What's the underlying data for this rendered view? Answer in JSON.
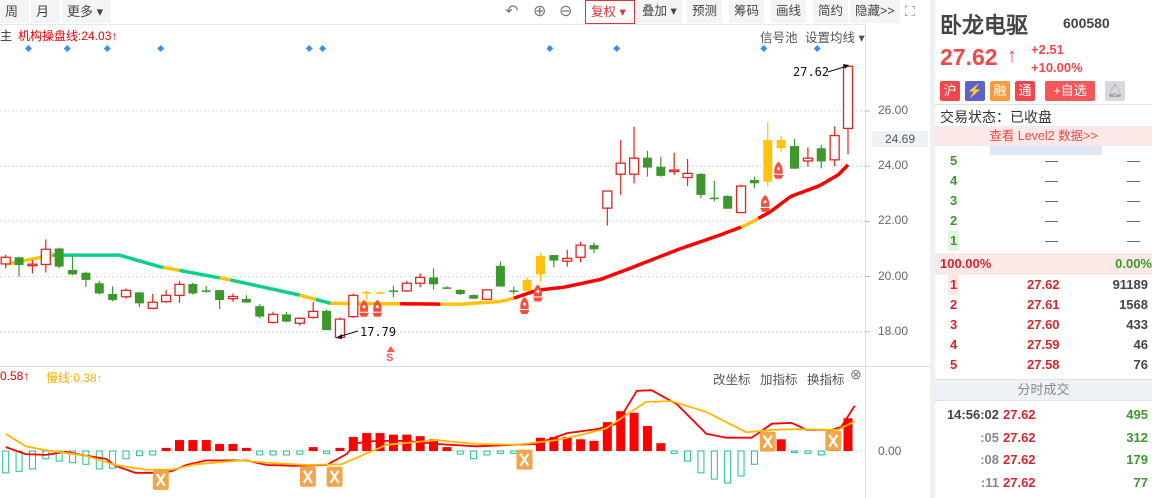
{
  "toolbar": {
    "left": [
      "周",
      "月",
      "更多 ▾"
    ],
    "fuquan": "复权 ▾",
    "right": [
      "叠加 ▾",
      "预测",
      "筹码",
      "画线",
      "简约",
      "隐藏>>"
    ]
  },
  "indicator_bar": {
    "main_cut": "主",
    "ma_label": "机构操盘线:24.03↑",
    "signal_pool": "信号池",
    "set_ma": "设置均线 ▾"
  },
  "price_axis": {
    "labels": [
      "26.00",
      "24.00",
      "22.00",
      "20.00",
      "18.00"
    ],
    "label_values": [
      26,
      24,
      22,
      20,
      18
    ],
    "current": "24.69",
    "current_value": 24.69
  },
  "annotations": {
    "high": "27.62",
    "low": "17.79",
    "s_mark": "S"
  },
  "colors": {
    "up": "#e0251f",
    "down": "#3d982c",
    "special": "#ffc20e",
    "teal": "#0ccf8a",
    "red_line": "#ff0000",
    "blue": "#3a8ff0"
  },
  "chart_data": {
    "type": "candlestick",
    "ohlc": [
      [
        20.46,
        20.8,
        20.3,
        20.7
      ],
      [
        20.7,
        20.72,
        20.0,
        20.42
      ],
      [
        20.43,
        20.6,
        20.12,
        20.45
      ],
      [
        20.44,
        21.35,
        20.15,
        20.99
      ],
      [
        21.02,
        21.05,
        20.3,
        20.36
      ],
      [
        20.24,
        20.76,
        20.05,
        20.08
      ],
      [
        20.14,
        20.18,
        19.63,
        19.88
      ],
      [
        19.76,
        19.85,
        19.35,
        19.39
      ],
      [
        19.37,
        19.65,
        19.1,
        19.15
      ],
      [
        19.27,
        19.57,
        19.2,
        19.5
      ],
      [
        19.43,
        19.45,
        18.9,
        19.03
      ],
      [
        18.85,
        19.37,
        18.82,
        19.07
      ],
      [
        19.09,
        19.52,
        19.05,
        19.32
      ],
      [
        19.32,
        19.84,
        19.05,
        19.72
      ],
      [
        19.73,
        19.78,
        19.35,
        19.39
      ],
      [
        19.5,
        19.66,
        19.42,
        19.48
      ],
      [
        19.51,
        19.52,
        18.82,
        19.15
      ],
      [
        19.2,
        19.39,
        19.09,
        19.28
      ],
      [
        19.19,
        19.33,
        19.05,
        19.06
      ],
      [
        18.93,
        19.0,
        18.5,
        18.55
      ],
      [
        18.34,
        18.73,
        18.3,
        18.63
      ],
      [
        18.63,
        18.72,
        18.35,
        18.37
      ],
      [
        18.31,
        18.52,
        18.22,
        18.49
      ],
      [
        18.52,
        19.08,
        18.47,
        18.74
      ],
      [
        18.76,
        18.81,
        18.06,
        18.06
      ],
      [
        17.8,
        18.52,
        17.79,
        18.46
      ],
      [
        18.55,
        19.39,
        18.5,
        19.32
      ],
      [
        19.42,
        19.49,
        19.15,
        19.44
      ],
      [
        19.41,
        19.48,
        19.38,
        19.43
      ],
      [
        19.5,
        19.67,
        19.25,
        19.48
      ],
      [
        19.48,
        19.85,
        19.45,
        19.76
      ],
      [
        19.76,
        20.12,
        19.61,
        19.97
      ],
      [
        19.97,
        20.3,
        19.53,
        19.72
      ],
      [
        19.61,
        19.65,
        19.55,
        19.59
      ],
      [
        19.52,
        19.54,
        19.33,
        19.37
      ],
      [
        19.33,
        19.36,
        19.2,
        19.2
      ],
      [
        19.18,
        19.55,
        19.17,
        19.52
      ],
      [
        20.39,
        20.54,
        19.63,
        19.64
      ],
      [
        19.5,
        19.64,
        19.36,
        19.48
      ],
      [
        19.49,
        19.98,
        19.45,
        19.88
      ],
      [
        20.08,
        20.87,
        19.82,
        20.75
      ],
      [
        20.78,
        20.79,
        20.34,
        20.58
      ],
      [
        20.56,
        20.97,
        20.36,
        20.66
      ],
      [
        20.7,
        21.26,
        20.52,
        21.14
      ],
      [
        21.14,
        21.23,
        20.85,
        20.99
      ],
      [
        22.48,
        23.1,
        21.85,
        23.1
      ],
      [
        23.71,
        24.95,
        22.96,
        24.11
      ],
      [
        23.71,
        25.43,
        23.38,
        24.29
      ],
      [
        24.31,
        24.56,
        23.62,
        23.95
      ],
      [
        23.98,
        24.35,
        23.62,
        23.65
      ],
      [
        23.83,
        24.49,
        23.68,
        23.86
      ],
      [
        23.59,
        24.26,
        23.28,
        23.74
      ],
      [
        23.72,
        23.75,
        22.84,
        22.96
      ],
      [
        22.86,
        23.47,
        22.72,
        22.82
      ],
      [
        22.92,
        22.95,
        22.46,
        22.46
      ],
      [
        22.32,
        23.33,
        22.3,
        23.28
      ],
      [
        23.5,
        23.62,
        23.2,
        23.38
      ],
      [
        23.44,
        25.6,
        23.26,
        24.95
      ],
      [
        24.95,
        25.1,
        24.5,
        24.65
      ],
      [
        24.73,
        24.99,
        23.91,
        23.91
      ],
      [
        24.19,
        24.68,
        23.99,
        24.29
      ],
      [
        24.65,
        24.77,
        23.92,
        24.17
      ],
      [
        24.23,
        25.44,
        24.0,
        25.11
      ],
      [
        25.37,
        27.63,
        24.43,
        27.62
      ]
    ],
    "special_bars": [
      27,
      28,
      39,
      40,
      57,
      58
    ],
    "ma_line": [
      [
        0,
        20.45
      ],
      [
        3.5,
        20.78
      ],
      [
        8.5,
        20.78
      ],
      [
        11.5,
        20.36
      ],
      [
        16.8,
        19.88
      ],
      [
        22,
        19.33
      ],
      [
        24.3,
        19.03
      ],
      [
        34,
        19.0
      ],
      [
        37,
        19.1
      ],
      [
        37.9,
        19.2
      ],
      [
        39.7,
        19.5
      ],
      [
        41.8,
        19.62
      ],
      [
        44.5,
        19.9
      ],
      [
        46.7,
        20.3
      ],
      [
        50.4,
        21.0
      ],
      [
        53.4,
        21.5
      ],
      [
        55.3,
        21.85
      ],
      [
        57.2,
        22.35
      ],
      [
        58.7,
        22.9
      ],
      [
        60.9,
        23.3
      ],
      [
        62.3,
        23.7
      ],
      [
        63,
        24.05
      ]
    ],
    "ma_color_segments": [
      [
        0,
        3.5,
        "yellow"
      ],
      [
        3.5,
        11.8,
        "teal"
      ],
      [
        11.8,
        13,
        "yellow"
      ],
      [
        13,
        16,
        "teal"
      ],
      [
        16,
        16.8,
        "yellow"
      ],
      [
        16.8,
        22,
        "teal"
      ],
      [
        22,
        23.2,
        "yellow"
      ],
      [
        23.2,
        24.3,
        "teal"
      ],
      [
        24.3,
        29.5,
        "yellow"
      ],
      [
        29.5,
        32.5,
        "red"
      ],
      [
        32.5,
        38,
        "yellow"
      ],
      [
        38,
        55,
        "red"
      ],
      [
        55,
        56.3,
        "yellow"
      ],
      [
        56.3,
        63,
        "red"
      ]
    ],
    "signal_diamonds": [
      1.7,
      4.6,
      7.6,
      11.6,
      22.7,
      23.7,
      40.7,
      45.7,
      56.7,
      60.7
    ],
    "rocket_marks": [
      [
        26.8,
        18.8
      ],
      [
        27.8,
        18.8
      ],
      [
        38.8,
        18.9
      ],
      [
        39.8,
        19.35
      ],
      [
        56.8,
        22.6
      ],
      [
        57.8,
        23.8
      ]
    ],
    "s_mark_bar": 28.8,
    "macd": {
      "fast_label": "0.58↑",
      "slow_label": "慢线:0.38↑",
      "zero_label": "0.00",
      "hist": [
        -0.28,
        -0.26,
        -0.23,
        -0.1,
        -0.13,
        -0.15,
        -0.17,
        -0.23,
        -0.22,
        -0.1,
        -0.06,
        -0.05,
        0.04,
        0.14,
        0.14,
        0.14,
        0.09,
        0.09,
        0.04,
        -0.05,
        -0.05,
        -0.05,
        -0.04,
        0.05,
        -0.03,
        0.04,
        0.18,
        0.23,
        0.23,
        0.21,
        0.21,
        0.19,
        0.15,
        0.05,
        -0.04,
        -0.1,
        -0.05,
        -0.03,
        -0.03,
        -0.05,
        0.17,
        0.18,
        0.18,
        0.15,
        0.13,
        0.37,
        0.51,
        0.49,
        0.32,
        0.1,
        -0.03,
        -0.13,
        -0.28,
        -0.36,
        -0.41,
        -0.32,
        -0.17,
        0.09,
        0.15,
        -0.01,
        -0.03,
        -0.05,
        0.09,
        0.42
      ],
      "fast": [
        [
          0,
          0.05
        ],
        [
          1.5,
          -0.04
        ],
        [
          3,
          -0.05
        ],
        [
          4.5,
          -0.01
        ],
        [
          6,
          -0.06
        ],
        [
          7.5,
          -0.1
        ],
        [
          8.2,
          -0.19
        ],
        [
          9.7,
          -0.28
        ],
        [
          11.2,
          -0.28
        ],
        [
          12.4,
          -0.26
        ],
        [
          13.5,
          -0.18
        ],
        [
          15,
          -0.12
        ],
        [
          18,
          -0.12
        ],
        [
          19.5,
          -0.18
        ],
        [
          21.7,
          -0.19
        ],
        [
          24,
          -0.18
        ],
        [
          25.5,
          -0.04
        ],
        [
          26.2,
          0.1
        ],
        [
          27.7,
          0.13
        ],
        [
          30,
          0.13
        ],
        [
          32.2,
          0.09
        ],
        [
          35.2,
          0.06
        ],
        [
          39.7,
          0.09
        ],
        [
          42,
          0.23
        ],
        [
          44.2,
          0.28
        ],
        [
          45.7,
          0.35
        ],
        [
          47.2,
          0.77
        ],
        [
          48.3,
          0.78
        ],
        [
          50.2,
          0.6
        ],
        [
          52.4,
          0.22
        ],
        [
          53.9,
          0.17
        ],
        [
          55.8,
          0.17
        ],
        [
          57.3,
          0.35
        ],
        [
          58.8,
          0.36
        ],
        [
          59.9,
          0.27
        ],
        [
          61.8,
          0.27
        ],
        [
          62.5,
          0.31
        ],
        [
          63.5,
          0.58
        ]
      ],
      "slow": [
        [
          0,
          0.22
        ],
        [
          1.5,
          0.06
        ],
        [
          3,
          0.01
        ],
        [
          6,
          -0.06
        ],
        [
          8.2,
          -0.18
        ],
        [
          10.5,
          -0.24
        ],
        [
          12.4,
          -0.24
        ],
        [
          14.2,
          -0.17
        ],
        [
          17.6,
          -0.12
        ],
        [
          19.5,
          -0.15
        ],
        [
          22.5,
          -0.18
        ],
        [
          25.1,
          -0.17
        ],
        [
          28.5,
          0.08
        ],
        [
          32.2,
          0.14
        ],
        [
          35.2,
          0.09
        ],
        [
          38.2,
          0.08
        ],
        [
          41.2,
          0.14
        ],
        [
          43.4,
          0.22
        ],
        [
          44.9,
          0.29
        ],
        [
          47.9,
          0.63
        ],
        [
          49.8,
          0.64
        ],
        [
          52.4,
          0.5
        ],
        [
          55.4,
          0.24
        ],
        [
          57.3,
          0.27
        ],
        [
          59.2,
          0.28
        ],
        [
          62.2,
          0.27
        ],
        [
          63.5,
          0.38
        ]
      ],
      "cross_marks": [
        [
          11.6,
          -0.37
        ],
        [
          22.6,
          -0.33
        ],
        [
          24.6,
          -0.33
        ],
        [
          38.8,
          -0.11
        ],
        [
          57,
          0.12
        ],
        [
          61.9,
          0.13
        ]
      ]
    }
  },
  "macd_buttons": [
    "改坐标",
    "加指标",
    "换指标"
  ],
  "stock": {
    "name": "卧龙电驱",
    "code": "600580",
    "price": "27.62",
    "arrow": "↑",
    "change": "+2.51",
    "change_pct": "+10.00%",
    "badges": [
      "沪",
      "融",
      "通",
      "+自选"
    ],
    "status": "交易状态：已收盘",
    "level2": "查看 Level2 数据>>"
  },
  "sell_orders": [
    {
      "level": "5",
      "price": "—",
      "vol": "—"
    },
    {
      "level": "4",
      "price": "—",
      "vol": "—"
    },
    {
      "level": "3",
      "price": "—",
      "vol": "—"
    },
    {
      "level": "2",
      "price": "—",
      "vol": "—"
    },
    {
      "level": "1",
      "price": "—",
      "vol": "—"
    }
  ],
  "ratio": {
    "left": "100.00%",
    "right": "0.00%"
  },
  "buy_orders": [
    {
      "level": "1",
      "price": "27.62",
      "vol": "91189"
    },
    {
      "level": "2",
      "price": "27.61",
      "vol": "1568"
    },
    {
      "level": "3",
      "price": "27.60",
      "vol": "433"
    },
    {
      "level": "4",
      "price": "27.59",
      "vol": "46"
    },
    {
      "level": "5",
      "price": "27.58",
      "vol": "76"
    }
  ],
  "ticks_title": "分时成交",
  "ticks": [
    {
      "time": "14:56:02",
      "price": "27.62",
      "vol": "495"
    },
    {
      "time": ":05",
      "price": "27.62",
      "vol": "312"
    },
    {
      "time": ":08",
      "price": "27.62",
      "vol": "179"
    },
    {
      "time": ":11",
      "price": "27.62",
      "vol": "77"
    }
  ]
}
